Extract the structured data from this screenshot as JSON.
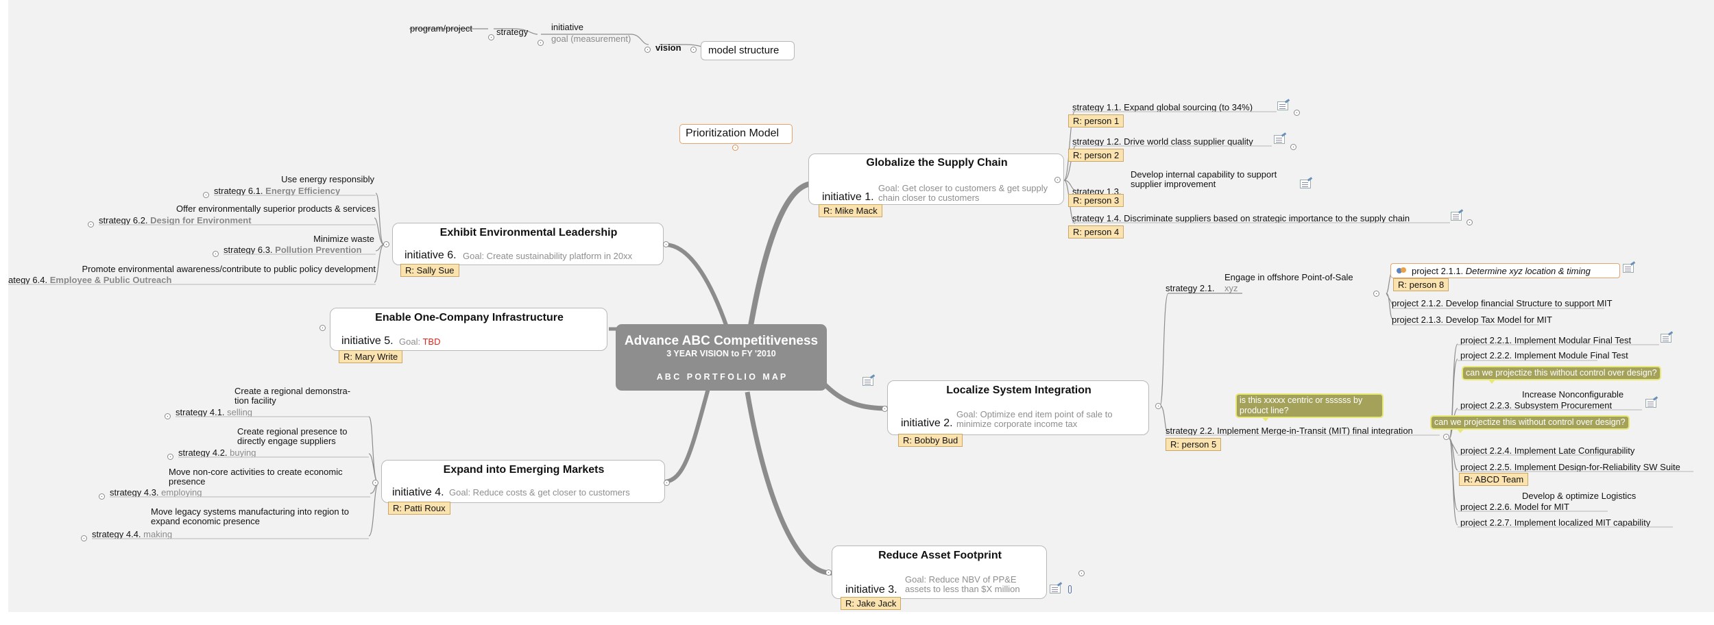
{
  "legend": {
    "program_project": "program/project",
    "strategy": "strategy",
    "initiative": "initiative",
    "goal": "goal (measurement)",
    "vision": "vision",
    "model_structure": "model structure"
  },
  "prioritization_model": "Prioritization Model",
  "central": {
    "title": "Advance ABC Competitiveness",
    "subtitle": "3 YEAR VISION to FY '2010",
    "caption": "A B C   P O R T F O L I O   M A P"
  },
  "initiatives": {
    "i1": {
      "title": "Globalize the Supply Chain",
      "label": "initiative 1.",
      "goal": "Goal: Get closer to customers & get supply chain closer to customers",
      "resp": "R: Mike Mack",
      "strategies": [
        {
          "label": "strategy 1.1.",
          "text": "Expand global sourcing (to 34%)",
          "resp": "R: person 1"
        },
        {
          "label": "strategy 1.2.",
          "text": "Drive world class supplier quality",
          "resp": "R: person 2"
        },
        {
          "label": "strategy 1.3.",
          "text": "Develop internal capability to support supplier improvement",
          "resp": "R: person 3"
        },
        {
          "label": "strategy 1.4.",
          "text": "Discriminate suppliers based on strategic importance to the supply chain",
          "resp": "R: person 4"
        }
      ]
    },
    "i2": {
      "title": "Localize System Integration",
      "label": "initiative 2.",
      "goal": "Goal: Optimize end item point of sale to minimize corporate income tax",
      "resp": "R: Bobby Bud",
      "s21": {
        "label": "strategy 2.1.",
        "title": "Engage in offshore Point-of-Sale",
        "sub": "xyz",
        "projects": [
          {
            "label": "project 2.1.1.",
            "text": "Determine xyz  location & timing",
            "resp": "R: person 8"
          },
          {
            "label": "project 2.1.2.",
            "text": "Develop financial Structure to support MIT"
          },
          {
            "label": "project 2.1.3.",
            "text": "Develop Tax Model for MIT"
          }
        ]
      },
      "s22": {
        "label": "strategy 2.2.",
        "text": "Implement Merge-in-Transit (MIT) final integration",
        "resp": "R: person 5",
        "callout": "is this xxxxx centric or ssssss by product line?",
        "projects": [
          {
            "label": "project 2.2.1.",
            "text": "Implement Modular Final Test"
          },
          {
            "label": "project 2.2.2.",
            "text": "Implement Module Final Test"
          },
          {
            "label": "project 2.2.3.",
            "text": "Subsystem Procurement",
            "above": "Increase Nonconfigurable",
            "callout": "can we projectize this without control over design?"
          },
          {
            "label": "project 2.2.4.",
            "text": "Implement Late Configurability",
            "callout": "can we projectize this without control over design?"
          },
          {
            "label": "project 2.2.5.",
            "text": "Implement Design-for-Reliability SW Suite",
            "resp": "R: ABCD Team"
          },
          {
            "label": "project 2.2.6.",
            "text": "Model for MIT",
            "above": "Develop & optimize Logistics"
          },
          {
            "label": "project 2.2.7.",
            "text": "Implement localized MIT capability"
          }
        ]
      }
    },
    "i3": {
      "title": "Reduce Asset Footprint",
      "label": "initiative 3.",
      "goal": "Goal: Reduce NBV of PP&E assets to less than $X million",
      "resp": "R: Jake Jack"
    },
    "i4": {
      "title": "Expand into Emerging Markets",
      "label": "initiative 4.",
      "goal": "Goal: Reduce costs & get closer to customers",
      "resp": "R: Patti Roux",
      "strategies": [
        {
          "label": "strategy 4.1.",
          "text": "Create a regional demonstra-tion facility",
          "sub": "selling"
        },
        {
          "label": "strategy 4.2.",
          "text": "Create regional presence to directly engage suppliers",
          "sub": "buying"
        },
        {
          "label": "strategy 4.3.",
          "text": "Move non-core activities to create economic presence",
          "sub": "employing"
        },
        {
          "label": "strategy 4.4.",
          "text": "Move legacy systems manufacturing into region to expand economic presence",
          "sub": "making"
        }
      ]
    },
    "i5": {
      "title": "Enable One-Company Infrastructure",
      "label": "initiative 5.",
      "goal_prefix": "Goal:",
      "goal_value": "TBD",
      "resp": "R: Mary Write"
    },
    "i6": {
      "title": "Exhibit Environmental Leadership",
      "label": "initiative 6.",
      "goal": "Goal: Create sustainability platform in 20xx",
      "resp": "R: Sally Sue",
      "strategies": [
        {
          "label": "strategy 6.1.",
          "text": "Use energy responsibly",
          "sub": "Energy Efficiency"
        },
        {
          "label": "strategy 6.2.",
          "text": "Offer environmentally superior products & services",
          "sub": "Design for Environment"
        },
        {
          "label": "strategy 6.3.",
          "text": "Minimize waste",
          "sub": "Pollution Prevention"
        },
        {
          "label": "ategy 6.4.",
          "text": "Promote environmental awareness/contribute to public policy development",
          "sub": "Employee & Public Outreach"
        }
      ]
    }
  },
  "colors": {
    "canvas": "#f2f2f2",
    "central": "#8e8e8e",
    "responsible": "#fbe3b0",
    "callout": "#a4a15b",
    "branch": "#8c8c8c"
  },
  "icons": [
    "note-icon",
    "attachment-icon",
    "collapse-icon",
    "task-icon"
  ]
}
